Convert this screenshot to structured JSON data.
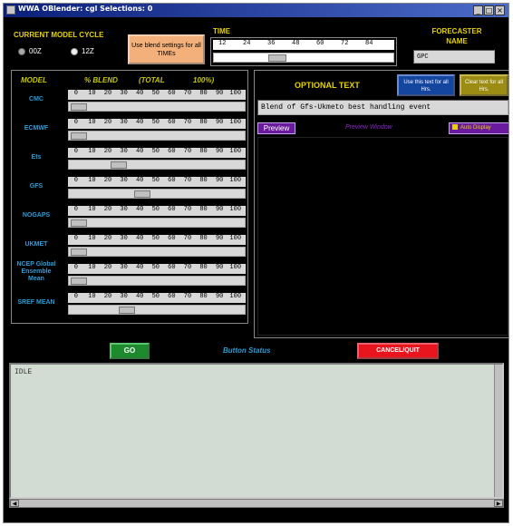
{
  "window": {
    "title": "WWA OBlender: cgl Selections: 0"
  },
  "titlebar_buttons": [
    "_",
    "□",
    "×"
  ],
  "model_cycle": {
    "title": "CURRENT MODEL CYCLE",
    "option1": "00Z",
    "option2": "12Z",
    "selected": "12Z"
  },
  "blend_button": {
    "label": "Use blend settings for all TIMEs"
  },
  "time": {
    "label": "TIME",
    "ticks": [
      "12",
      "24",
      "36",
      "48",
      "60",
      "72",
      "84"
    ],
    "slider_value": 36
  },
  "forecaster": {
    "label": "FORECASTER NAME",
    "value": "GPC"
  },
  "table_header": {
    "model": "MODEL",
    "blend": "% BLEND",
    "total": "(TOTAL",
    "pct": "100%)"
  },
  "slider_ticks": [
    "0",
    "10",
    "20",
    "30",
    "40",
    "50",
    "60",
    "70",
    "80",
    "90",
    "100"
  ],
  "models": [
    {
      "name": "CMC",
      "value": 0
    },
    {
      "name": "ECMWF",
      "value": 0
    },
    {
      "name": "Ets",
      "value": 25
    },
    {
      "name": "GFS",
      "value": 40
    },
    {
      "name": "NOGAPS",
      "value": 0
    },
    {
      "name": "UKMET",
      "value": 0
    },
    {
      "name": "NCEP Global Ensemble Mean",
      "value": 0
    },
    {
      "name": "SREF MEAN",
      "value": 30
    }
  ],
  "optional_text": {
    "label": "OPTIONAL TEXT",
    "value": "Blend of Gfs-Ukmeto best handling event",
    "use_button": "Use this text for all Hrs.",
    "clear_button": "Clear text for all Hrs."
  },
  "preview": {
    "button": "Preview",
    "window_label": "Preview Window",
    "auto_display": "Auto Display"
  },
  "bottom_bar": {
    "go": "GO",
    "status_label": "Button Status",
    "cancel": "CANCEL/QUIT"
  },
  "log": {
    "text": "IDLE"
  },
  "colors": {
    "yellow": "#e6d200",
    "cyan": "#2d9cd8",
    "go_green": "#1e8a2e",
    "cancel_red": "#e8141e",
    "use_blue": "#1446a0",
    "clear_olive": "#9c8c14",
    "preview_purple": "#6a1a9e"
  }
}
